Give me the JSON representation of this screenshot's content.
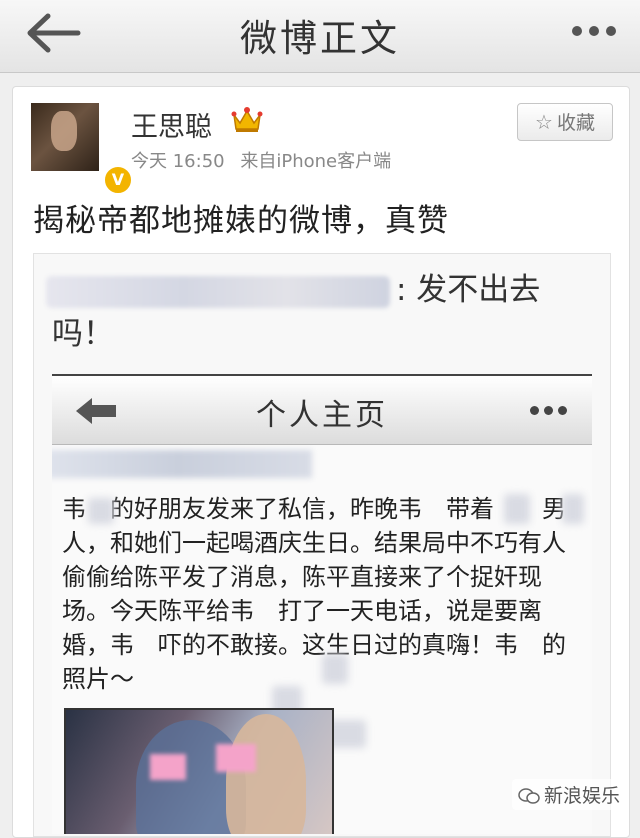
{
  "nav": {
    "title": "微博正文"
  },
  "post": {
    "author": "王思聪",
    "time": "今天 16:50",
    "source": "来自iPhone客户端",
    "favorite_label": "收藏",
    "text": "揭秘帝都地摊婊的微博，真赞",
    "verified_badge": "V"
  },
  "retweet": {
    "text_line1": ": 发不出去",
    "text_line2": "吗！",
    "embed": {
      "title": "个人主页",
      "body": "韦　的好朋友发来了私信，昨晚韦　带着　　男人，和她们一起喝酒庆生日。结果局中不巧有人偷偷给陈平发了消息，陈平直接来了个捉奸现场。今天陈平给韦　打了一天电话，说是要离婚，韦　吓的不敢接。这生日过的真嗨！韦　的　　照片～"
    }
  },
  "watermark": {
    "text": "新浪娱乐"
  },
  "colors": {
    "verified_badge": "#f3b400",
    "crown": "#e0a100",
    "meta_text": "#888888"
  },
  "icons": [
    "back-arrow-icon",
    "more-dots-icon",
    "crown-icon",
    "star-icon",
    "verified-icon",
    "wechat-icon"
  ]
}
